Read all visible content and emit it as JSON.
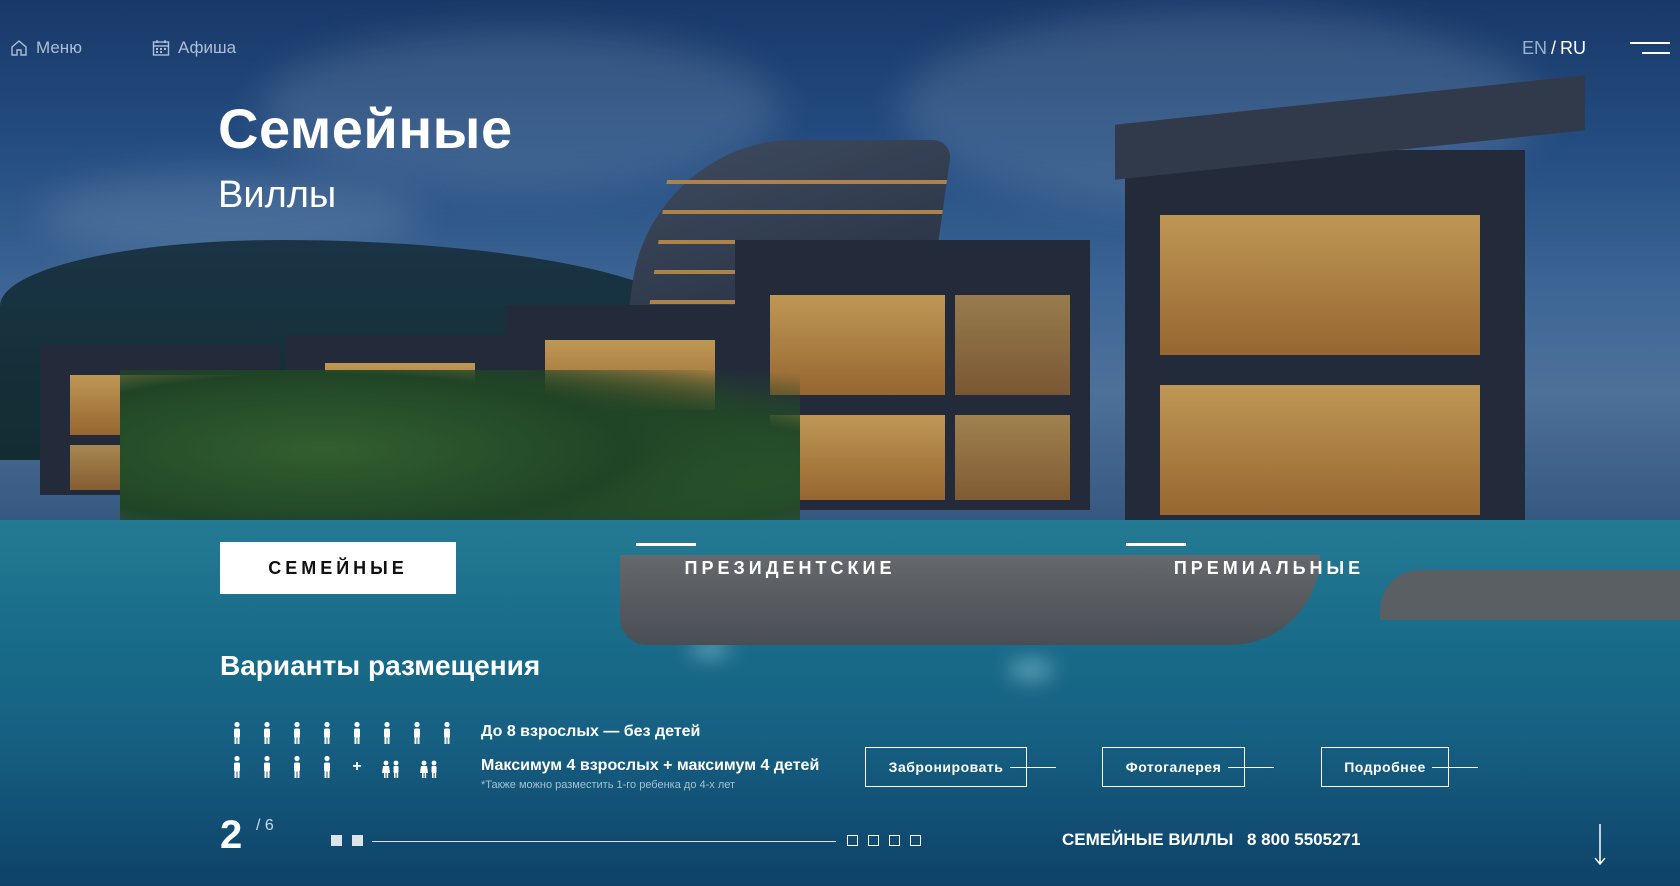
{
  "nav": {
    "menu_label": "Меню",
    "menu_icon": "home-icon",
    "events_label": "Афиша",
    "events_icon": "calendar-icon"
  },
  "lang": {
    "en": "EN",
    "separator": "/",
    "ru": "RU",
    "active": "RU"
  },
  "hero": {
    "title": "Семейные",
    "subtitle": "Виллы"
  },
  "tabs": [
    {
      "label": "СЕМЕЙНЫЕ",
      "active": true
    },
    {
      "label": "ПРЕЗИДЕНТСКИЕ",
      "active": false
    },
    {
      "label": "ПРЕМИАЛЬНЫЕ",
      "active": false
    }
  ],
  "accommodation": {
    "title": "Варианты размещения",
    "option1": "До 8 взрослых — без детей",
    "option2": "Максимум 4 взрослых + максимум 4 детей",
    "note": "*Также можно разместить 1-го ребенка до 4-х лет",
    "plus": "+"
  },
  "buttons": {
    "book": "Забронировать",
    "gallery": "Фотогалерея",
    "details": "Подробнее"
  },
  "pager": {
    "current": "2",
    "total": "/ 6"
  },
  "footer": {
    "name": "СЕМЕЙНЫЕ ВИЛЛЫ",
    "phone": "8 800 5505271"
  },
  "colors": {
    "accent": "#ffffff",
    "tab_active_text": "#111111"
  }
}
